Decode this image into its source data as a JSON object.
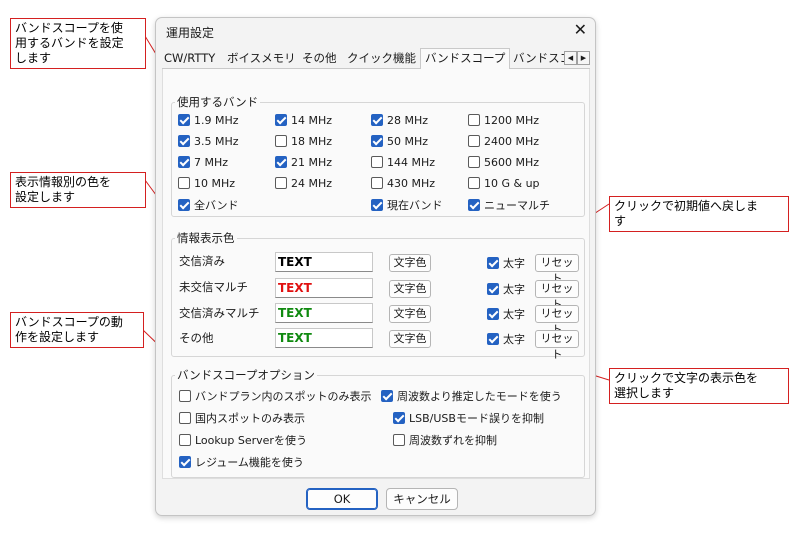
{
  "callouts": {
    "bands": "バンドスコープを使\n用するバンドを設定\nします",
    "colors": "表示情報別の色を\n設定します",
    "behavior": "バンドスコープの動\n作を設定します",
    "reset": "クリックで初期値へ戻しま\nす",
    "textcolor": "クリックで文字の表示色を\n選択します"
  },
  "dialog": {
    "title": "運用設定",
    "close": "✕",
    "tabs": [
      "CW/RTTY",
      "ボイスメモリ",
      "その他",
      "クイック機能",
      "バンドスコープ",
      "バンドスコ"
    ],
    "scroll_left": "◀",
    "scroll_right": "▶",
    "bands_group": {
      "title": "使用するバンド",
      "items": [
        {
          "label": "1.9 MHz",
          "checked": true
        },
        {
          "label": "14 MHz",
          "checked": true
        },
        {
          "label": "28 MHz",
          "checked": true
        },
        {
          "label": "1200 MHz",
          "checked": false
        },
        {
          "label": "3.5 MHz",
          "checked": true
        },
        {
          "label": "18 MHz",
          "checked": false
        },
        {
          "label": "50 MHz",
          "checked": true
        },
        {
          "label": "2400 MHz",
          "checked": false
        },
        {
          "label": "7 MHz",
          "checked": true
        },
        {
          "label": "21 MHz",
          "checked": true
        },
        {
          "label": "144 MHz",
          "checked": false
        },
        {
          "label": "5600 MHz",
          "checked": false
        },
        {
          "label": "10 MHz",
          "checked": false
        },
        {
          "label": "24 MHz",
          "checked": false
        },
        {
          "label": "430 MHz",
          "checked": false
        },
        {
          "label": "10 G & up",
          "checked": false
        },
        {
          "label": "全バンド",
          "checked": true
        },
        {
          "label": "現在バンド",
          "checked": true
        },
        {
          "label": "ニューマルチ",
          "checked": true
        }
      ]
    },
    "colors_group": {
      "title": "情報表示色",
      "rows": [
        {
          "label": "交信済み",
          "sample": "TEXT",
          "color": "#000000",
          "btn": "文字色",
          "bold_label": "太字",
          "bold": true,
          "reset": "リセット"
        },
        {
          "label": "未交信マルチ",
          "sample": "TEXT",
          "color": "#e01010",
          "btn": "文字色",
          "bold_label": "太字",
          "bold": true,
          "reset": "リセット"
        },
        {
          "label": "交信済みマルチ",
          "sample": "TEXT",
          "color": "#108a10",
          "btn": "文字色",
          "bold_label": "太字",
          "bold": true,
          "reset": "リセット"
        },
        {
          "label": "その他",
          "sample": "TEXT",
          "color": "#108a10",
          "btn": "文字色",
          "bold_label": "太字",
          "bold": true,
          "reset": "リセット"
        }
      ]
    },
    "options_group": {
      "title": "バンドスコープオプション",
      "items": [
        {
          "label": "バンドプラン内のスポットのみ表示",
          "checked": false
        },
        {
          "label": "周波数より推定したモードを使う",
          "checked": true
        },
        {
          "label": "国内スポットのみ表示",
          "checked": false
        },
        {
          "label": "LSB/USBモード誤りを抑制",
          "checked": true
        },
        {
          "label": "Lookup Serverを使う",
          "checked": false
        },
        {
          "label": "周波数ずれを抑制",
          "checked": false
        },
        {
          "label": "レジューム機能を使う",
          "checked": true
        }
      ]
    },
    "ok": "OK",
    "cancel": "キャンセル"
  }
}
